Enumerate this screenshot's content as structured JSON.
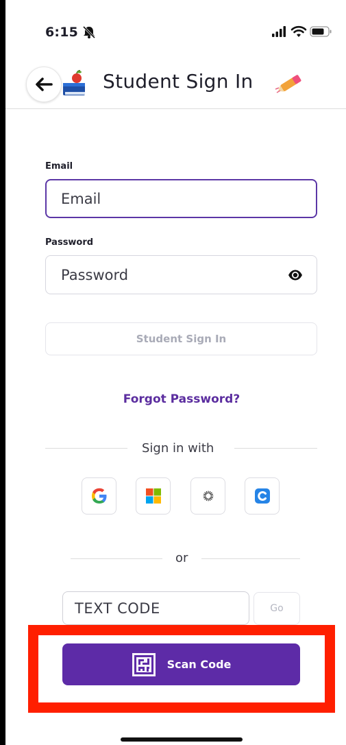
{
  "status_bar": {
    "time": "6:15"
  },
  "header": {
    "title": "Student Sign In"
  },
  "form": {
    "email_label": "Email",
    "email_placeholder": "Email",
    "password_label": "Password",
    "password_placeholder": "Password",
    "signin_button": "Student Sign In",
    "forgot_password": "Forgot Password?"
  },
  "sso": {
    "label": "Sign in with",
    "providers": [
      "google-icon",
      "microsoft-icon",
      "clever-sunburst-icon",
      "classlink-icon"
    ]
  },
  "alt": {
    "or_label": "or",
    "code_placeholder": "TEXT CODE",
    "go_button": "Go",
    "scan_button": "Scan Code"
  },
  "colors": {
    "brand_purple": "#5d2ba7",
    "link_purple": "#5b2d9f",
    "highlight_red": "#ff1f00"
  }
}
